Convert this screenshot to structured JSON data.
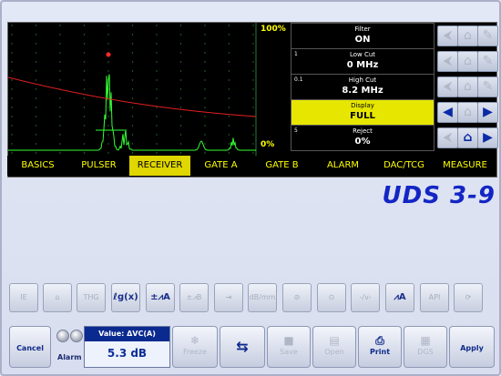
{
  "scope": {
    "label_top": "100%",
    "label_bottom": "0%"
  },
  "params": [
    {
      "index": "",
      "name": "Filter",
      "value": "ON"
    },
    {
      "index": "1",
      "name": "Low Cut",
      "value": "0 MHz"
    },
    {
      "index": "0.1",
      "name": "High Cut",
      "value": "8.2 MHz"
    },
    {
      "index": "",
      "name": "Display",
      "value": "FULL"
    },
    {
      "index": "5",
      "name": "Reject",
      "value": "0%"
    }
  ],
  "tabs": [
    "BASICS",
    "PULSER",
    "RECEIVER",
    "GATE A",
    "GATE B",
    "ALARM",
    "DAC/TCG",
    "MEASURE"
  ],
  "active_tab": "RECEIVER",
  "logo": "UDS 3-9",
  "toolbar": [
    {
      "label": "IE",
      "icon": "ie-icon"
    },
    {
      "label": "⌂",
      "icon": "probe-icon"
    },
    {
      "label": "THG",
      "icon": "thg-icon"
    },
    {
      "label": "ℓg(x)",
      "icon": "log-icon"
    },
    {
      "label": "±⩘A",
      "icon": "gain-adjust-icon"
    },
    {
      "label": "±⩘B",
      "icon": "gain-adjust-b-icon"
    },
    {
      "label": "⇥",
      "icon": "range-icon"
    },
    {
      "label": "dB/mm",
      "icon": "db-mm-icon"
    },
    {
      "label": "⊘",
      "icon": "envelope-icon"
    },
    {
      "label": "⊙",
      "icon": "peak-icon"
    },
    {
      "label": "-/v-",
      "icon": "waveform-icon"
    },
    {
      "label": "⩘A",
      "icon": "gate-peaks-icon"
    },
    {
      "label": "API",
      "icon": "api-icon"
    },
    {
      "label": "⟳",
      "icon": "rotate-icon"
    }
  ],
  "bottom": {
    "cancel": "Cancel",
    "alarm": "Alarm",
    "value_title": "Value: ΔVC(A)",
    "value": "5.3 dB",
    "freeze": "Freeze",
    "swap": "",
    "save": "Save",
    "open": "Open",
    "print": "Print",
    "dgs": "DGS",
    "apply": "Apply"
  },
  "colors": {
    "accent": "#0b2a8f",
    "trace": "#33ff33",
    "dac_curve": "#e02020",
    "tab_text": "#ffff00",
    "active": "#e0d600"
  }
}
